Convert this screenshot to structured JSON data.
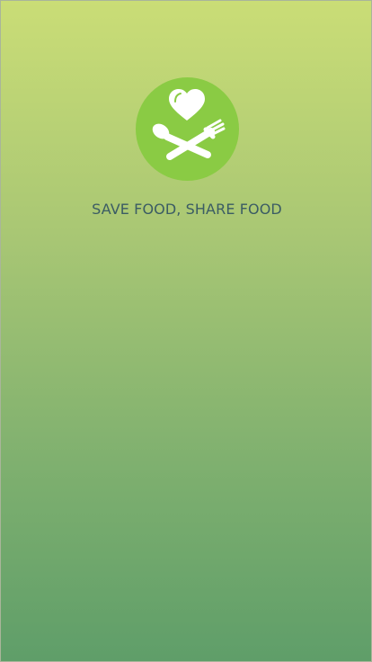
{
  "splash": {
    "logo_icon": "heart-spoon-fork-icon",
    "tagline": "SAVE FOOD, SHARE FOOD",
    "colors": {
      "gradient_top": "#cadd76",
      "gradient_bottom": "#5f9e69",
      "logo_circle": "#8acb44",
      "tagline": "#3b5c64"
    }
  }
}
